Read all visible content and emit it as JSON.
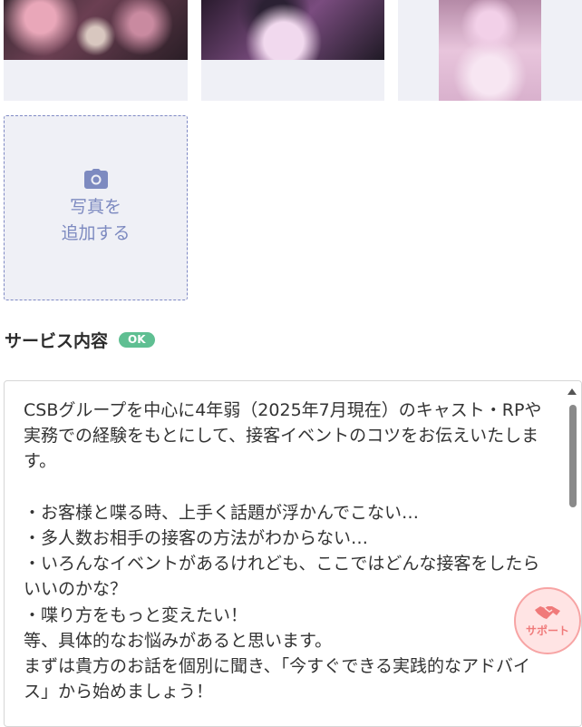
{
  "photos": [
    {
      "alt_icon": "photo-thumbnail"
    },
    {
      "alt_icon": "photo-thumbnail"
    },
    {
      "alt_icon": "photo-thumbnail"
    }
  ],
  "add_photo": {
    "icon": "camera-icon",
    "line1": "写真を",
    "line2": "追加する"
  },
  "service": {
    "title": "サービス内容",
    "badge": "OK",
    "badge_color": "#5fbf92",
    "body": "CSBグループを中心に4年弱（2025年7月現在）のキャスト・RPや実務での経験をもとにして、接客イベントのコツをお伝えいたします。\n\n・お客様と喋る時、上手く話題が浮かんでこない…\n・多人数お相手の接客の方法がわからない…\n・いろんなイベントがあるけれども、ここではどんな接客をしたらいいのかな？\n・喋り方をもっと変えたい！\n等、具体的なお悩みがあると思います。\nまずは貴方のお話を個別に聞き、「今すぐできる実践的なアドバイス」から始めましょう！"
  },
  "support": {
    "icon": "handshake-icon",
    "label": "サポート",
    "color": "#f07a7a"
  }
}
